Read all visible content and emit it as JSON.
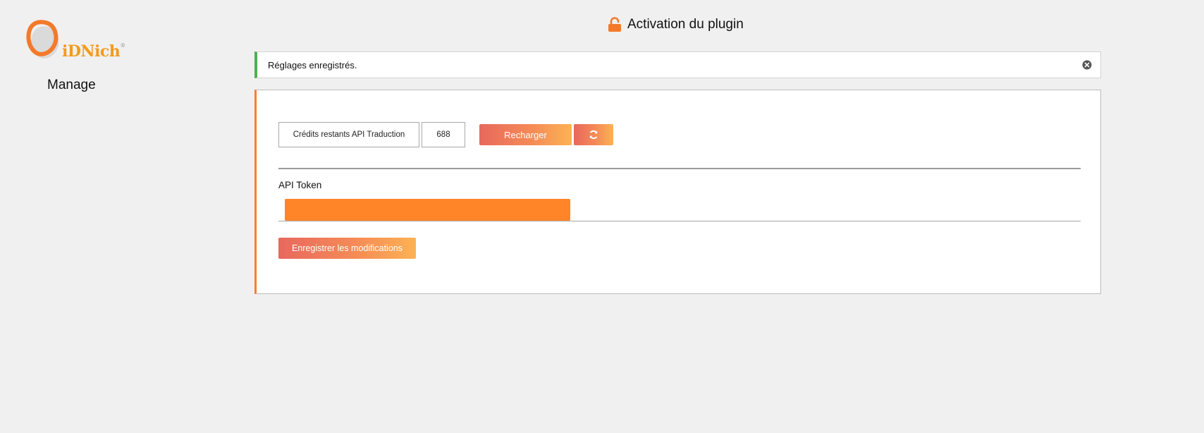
{
  "brand": {
    "logo_text": "iDNich",
    "logo_reg": "®",
    "section": "Manage"
  },
  "page": {
    "title": "Activation du plugin",
    "title_icon": "unlock-icon"
  },
  "notice": {
    "message": "Réglages enregistrés.",
    "dismiss_icon": "close-circle-icon",
    "accent_color": "#4caf50"
  },
  "credits": {
    "label": "Crédits restants API Traduction",
    "value": "688",
    "reload_label": "Recharger",
    "refresh_icon": "refresh-icon"
  },
  "token": {
    "label": "API Token",
    "value_redacted": true
  },
  "actions": {
    "save_label": "Enregistrer les modifications"
  },
  "colors": {
    "accent": "#ff7d27",
    "gradient_start": "#e8685d",
    "gradient_end": "#fcb254",
    "background": "#f0f0f0"
  }
}
